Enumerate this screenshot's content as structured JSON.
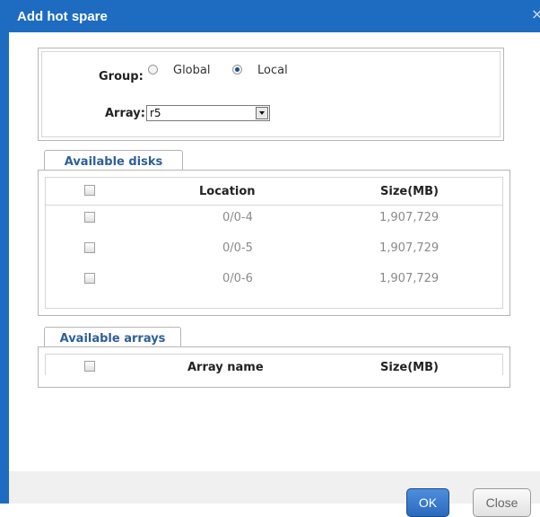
{
  "dialog": {
    "title": "Add hot spare",
    "close_glyph": "×"
  },
  "group": {
    "label": "Group:",
    "options": [
      {
        "label": "Global",
        "checked": false
      },
      {
        "label": "Local",
        "checked": true
      }
    ]
  },
  "array_select": {
    "label": "Array:",
    "value": "r5"
  },
  "available_disks": {
    "tab_label": "Available disks",
    "columns": [
      "Location",
      "Size(MB)"
    ],
    "rows": [
      {
        "location": "0/0-4",
        "size": "1,907,729"
      },
      {
        "location": "0/0-5",
        "size": "1,907,729"
      },
      {
        "location": "0/0-6",
        "size": "1,907,729"
      }
    ]
  },
  "available_arrays": {
    "tab_label": "Available arrays",
    "columns": [
      "Array name",
      "Size(MB)"
    ],
    "rows": []
  },
  "footer": {
    "ok_label": "OK",
    "close_label": "Close"
  },
  "colors": {
    "frame": "#1d6cc1",
    "tab_text": "#2f5f97",
    "ok_button": "#2b69bc"
  },
  "icons": {
    "close": "close-icon",
    "dropdown": "chevron-down-icon"
  }
}
